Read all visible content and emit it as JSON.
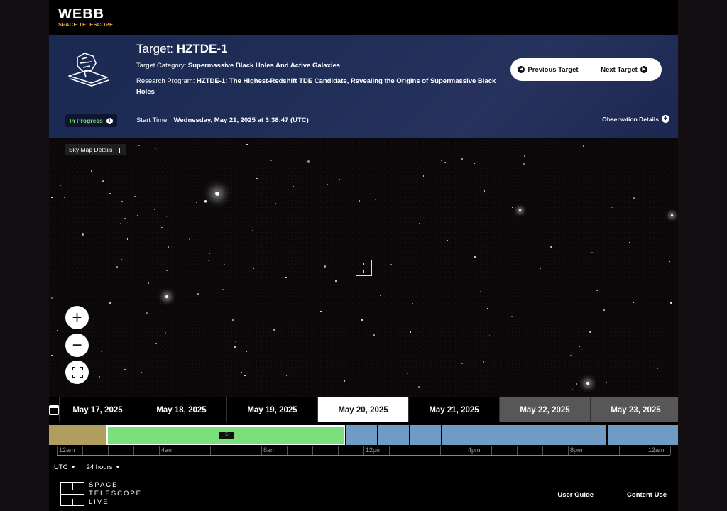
{
  "brand": {
    "name": "WEBB",
    "tagline": "SPACE TELESCOPE"
  },
  "target": {
    "label": "Target:",
    "name": "HZTDE-1",
    "category_label": "Target Category:",
    "category": "Supermassive Black Holes And Active Galaxies",
    "program_label": "Research Program:",
    "program": "HZTDE-1: The Highest-Redshift TDE Candidate, Revealing the Origins of Supermassive Black Holes",
    "start_label": "Start Time:",
    "start_time": "Wednesday, May 21, 2025 at 3:38:47 (UTC)",
    "status": "In Progress"
  },
  "nav": {
    "previous": "Previous Target",
    "next": "Next Target"
  },
  "observation_details": "Observation Details",
  "sky_map_details": "Sky Map Details",
  "dates": [
    {
      "label": "May 17, 2025",
      "state": "past"
    },
    {
      "label": "May 18, 2025",
      "state": "past"
    },
    {
      "label": "May 19, 2025",
      "state": "past"
    },
    {
      "label": "May 20, 2025",
      "state": "active"
    },
    {
      "label": "May 21, 2025",
      "state": "past"
    },
    {
      "label": "May 22, 2025",
      "state": "future"
    },
    {
      "label": "May 23, 2025",
      "state": "future"
    }
  ],
  "timeline": {
    "active_chip": "5",
    "time_labels": [
      "12am",
      "4am",
      "8am",
      "12pm",
      "4pm",
      "8pm",
      "12am"
    ]
  },
  "controls": {
    "timezone": "UTC",
    "range": "24 hours"
  },
  "footer": {
    "logo_lines": [
      "SPACE",
      "TELESCOPE",
      "LIVE"
    ],
    "links": [
      "User Guide",
      "Content Use"
    ]
  },
  "colors": {
    "header_bg": "#1f2d57",
    "status_green": "#7fe070",
    "segment_done": "#b19d5d",
    "segment_active": "#7be07b",
    "segment_planned": "#6f9bc4",
    "logo_orange": "#f2a93b"
  }
}
